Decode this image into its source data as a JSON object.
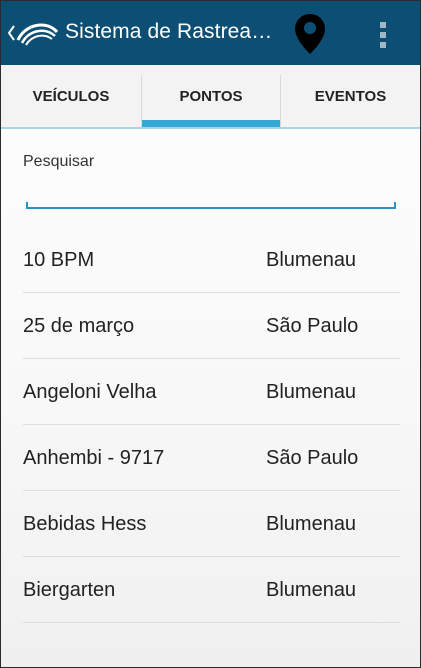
{
  "app": {
    "title": "Sistema de Rastrea…"
  },
  "icons": {
    "back": "back-arrow-icon",
    "logo": "app-logo-icon",
    "map": "map-pin-icon",
    "menu": "overflow-menu-icon"
  },
  "colors": {
    "appbar": "#0d4f74",
    "accent": "#33a7d6",
    "underline": "#2a91c0"
  },
  "tabs": [
    {
      "label": "VEÍCULOS",
      "selected": false
    },
    {
      "label": "PONTOS",
      "selected": true
    },
    {
      "label": "EVENTOS",
      "selected": false
    }
  ],
  "search": {
    "label": "Pesquisar",
    "value": ""
  },
  "points": [
    {
      "name": "10 BPM",
      "city": "Blumenau"
    },
    {
      "name": "25 de março",
      "city": "São Paulo"
    },
    {
      "name": "Angeloni Velha",
      "city": "Blumenau"
    },
    {
      "name": "Anhembi - 9717",
      "city": "São Paulo"
    },
    {
      "name": "Bebidas Hess",
      "city": "Blumenau"
    },
    {
      "name": "Biergarten",
      "city": "Blumenau"
    }
  ]
}
